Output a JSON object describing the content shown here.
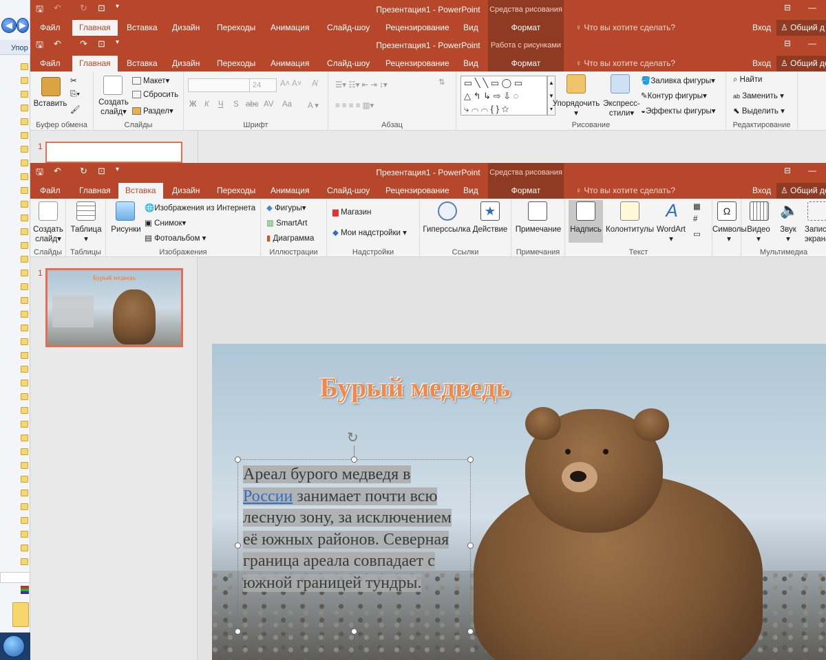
{
  "explorer": {
    "label_top": "Упор"
  },
  "window1": {
    "title": "Презентация1 - PowerPoint",
    "context_header": "Средства рисования",
    "tabs": [
      "Файл",
      "Главная",
      "Вставка",
      "Дизайн",
      "Переходы",
      "Анимация",
      "Слайд-шоу",
      "Рецензирование",
      "Вид"
    ],
    "active_tab": "Главная",
    "context_tab": "Формат",
    "tell_me": "Что вы хотите сделать?",
    "login": "Вход",
    "share": "Общий д"
  },
  "window2": {
    "title": "Презентация1 - PowerPoint",
    "context_header": "Работа с рисунками",
    "tabs": [
      "Файл",
      "Главная",
      "Вставка",
      "Дизайн",
      "Переходы",
      "Анимация",
      "Слайд-шоу",
      "Рецензирование",
      "Вид"
    ],
    "active_tab": "Главная",
    "context_tab": "Формат",
    "tell_me": "Что вы хотите сделать?",
    "login": "Вход",
    "share": "Общий до",
    "ribbon": {
      "clipboard": {
        "paste": "Вставить",
        "label": "Буфер обмена"
      },
      "slides": {
        "new_slide": "Создать",
        "new_slide2": "слайд",
        "layout": "Макет",
        "reset": "Сбросить",
        "section": "Раздел",
        "label": "Слайды"
      },
      "font": {
        "size": "24",
        "bold": "Ж",
        "italic": "К",
        "underline": "Ч",
        "shadow": "S",
        "strike": "abc",
        "spacing": "AV",
        "case": "Aa",
        "label": "Шрифт"
      },
      "paragraph": {
        "label": "Абзац"
      },
      "drawing": {
        "arrange": "Упорядочить",
        "quick_styles": "Экспресс-",
        "quick_styles2": "стили",
        "fill": "Заливка фигуры",
        "outline": "Контур фигуры",
        "effects": "Эффекты фигуры",
        "label": "Рисование"
      },
      "editing": {
        "find": "Найти",
        "replace": "Заменить",
        "select": "Выделить",
        "label": "Редактирование"
      }
    },
    "thumb_num": "1"
  },
  "window3": {
    "title": "Презентация1 - PowerPoint",
    "context_header": "Средства рисования",
    "tabs": [
      "Файл",
      "Главная",
      "Вставка",
      "Дизайн",
      "Переходы",
      "Анимация",
      "Слайд-шоу",
      "Рецензирование",
      "Вид"
    ],
    "active_tab": "Вставка",
    "context_tab": "Формат",
    "tell_me": "Что вы хотите сделать?",
    "login": "Вход",
    "share": "Общий до",
    "ribbon": {
      "slides": {
        "new_slide": "Создать",
        "new_slide2": "слайд",
        "label": "Слайды"
      },
      "tables": {
        "table": "Таблица",
        "label": "Таблицы"
      },
      "images": {
        "pictures": "Рисунки",
        "online": "Изображения из Интернета",
        "screenshot": "Снимок",
        "album": "Фотоальбом",
        "label": "Изображения"
      },
      "illustrations": {
        "shapes": "Фигуры",
        "smartart": "SmartArt",
        "chart": "Диаграмма",
        "label": "Иллюстрации"
      },
      "addins": {
        "store": "Магазин",
        "my_addins": "Мои надстройки",
        "label": "Надстройки"
      },
      "links": {
        "hyperlink": "Гиперссылка",
        "action": "Действие",
        "label": "Ссылки"
      },
      "comments": {
        "comment": "Примечание",
        "label": "Примечания"
      },
      "text": {
        "textbox": "Надпись",
        "header_footer": "Колонтитулы",
        "wordart": "WordArt",
        "label": "Текст"
      },
      "symbols": {
        "symbols": "Символы"
      },
      "media": {
        "video": "Видео",
        "audio": "Звук",
        "record": "Запись",
        "record2": "экрана",
        "label": "Мультимедиа"
      }
    }
  },
  "slide": {
    "number": "1",
    "title": "Бурый медведь",
    "text_before_link": "Ареал бурого медведя в ",
    "link": "России",
    "text_after_link": " занимает почти всю лесную зону, за исключением её южных районов. Северная граница ареала совпадает с южной границей тундры."
  },
  "colors": {
    "accent": "#b7472a",
    "context": "#8f3a22",
    "title_orange": "#f08a4b",
    "link": "#2f6fc4"
  }
}
